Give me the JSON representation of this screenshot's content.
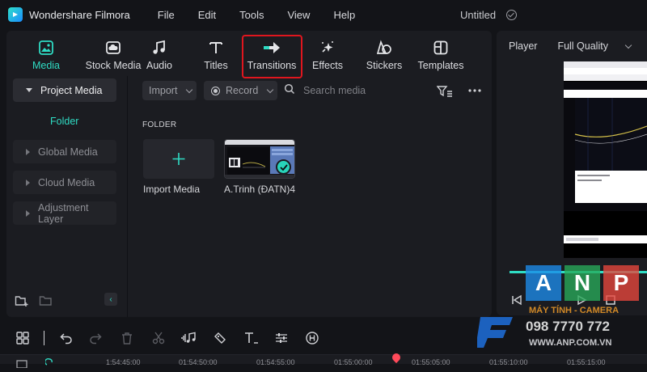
{
  "app": {
    "title": "Wondershare Filmora",
    "doc_title": "Untitled"
  },
  "menu": [
    "File",
    "Edit",
    "Tools",
    "View",
    "Help"
  ],
  "toolbar": {
    "tabs": [
      {
        "label": "Media",
        "icon": "media-icon",
        "active": true
      },
      {
        "label": "Stock Media",
        "icon": "cloud-box-icon"
      },
      {
        "label": "Audio",
        "icon": "music-note-icon"
      },
      {
        "label": "Titles",
        "icon": "text-t-icon"
      },
      {
        "label": "Transitions",
        "icon": "transition-arrows-icon",
        "highlighted": true
      },
      {
        "label": "Effects",
        "icon": "sparkle-icon"
      },
      {
        "label": "Stickers",
        "icon": "sticker-icon"
      },
      {
        "label": "Templates",
        "icon": "template-icon"
      }
    ]
  },
  "sidebar": {
    "items": [
      {
        "label": "Project Media",
        "selected": true
      },
      {
        "label": "Global Media"
      },
      {
        "label": "Cloud Media"
      },
      {
        "label": "Adjustment Layer"
      }
    ],
    "folder_label": "Folder"
  },
  "content": {
    "import_label": "Import",
    "record_label": "Record",
    "search_placeholder": "Search media",
    "section_label": "FOLDER",
    "items": [
      {
        "caption": "Import Media"
      },
      {
        "caption": "A.Trinh  (ĐATN)4"
      }
    ]
  },
  "player": {
    "label": "Player",
    "quality": "Full Quality",
    "progress": 1.0
  },
  "timeline": {
    "timecodes": [
      "1:54:45:00",
      "01:54:50:00",
      "01:54:55:00",
      "01:55:00:00",
      "01:55:05:00",
      "01:55:10:00",
      "01:55:15:00"
    ]
  },
  "watermark": {
    "letters": [
      "A",
      "N",
      "P"
    ],
    "line1": "MÁY TÍNH - CAMERA",
    "phone": "098 7770 772",
    "web": "WWW.ANP.COM.VN"
  },
  "colors": {
    "accent": "#2fdcc4",
    "highlight": "#e0161e",
    "panel": "#1b1c21"
  }
}
